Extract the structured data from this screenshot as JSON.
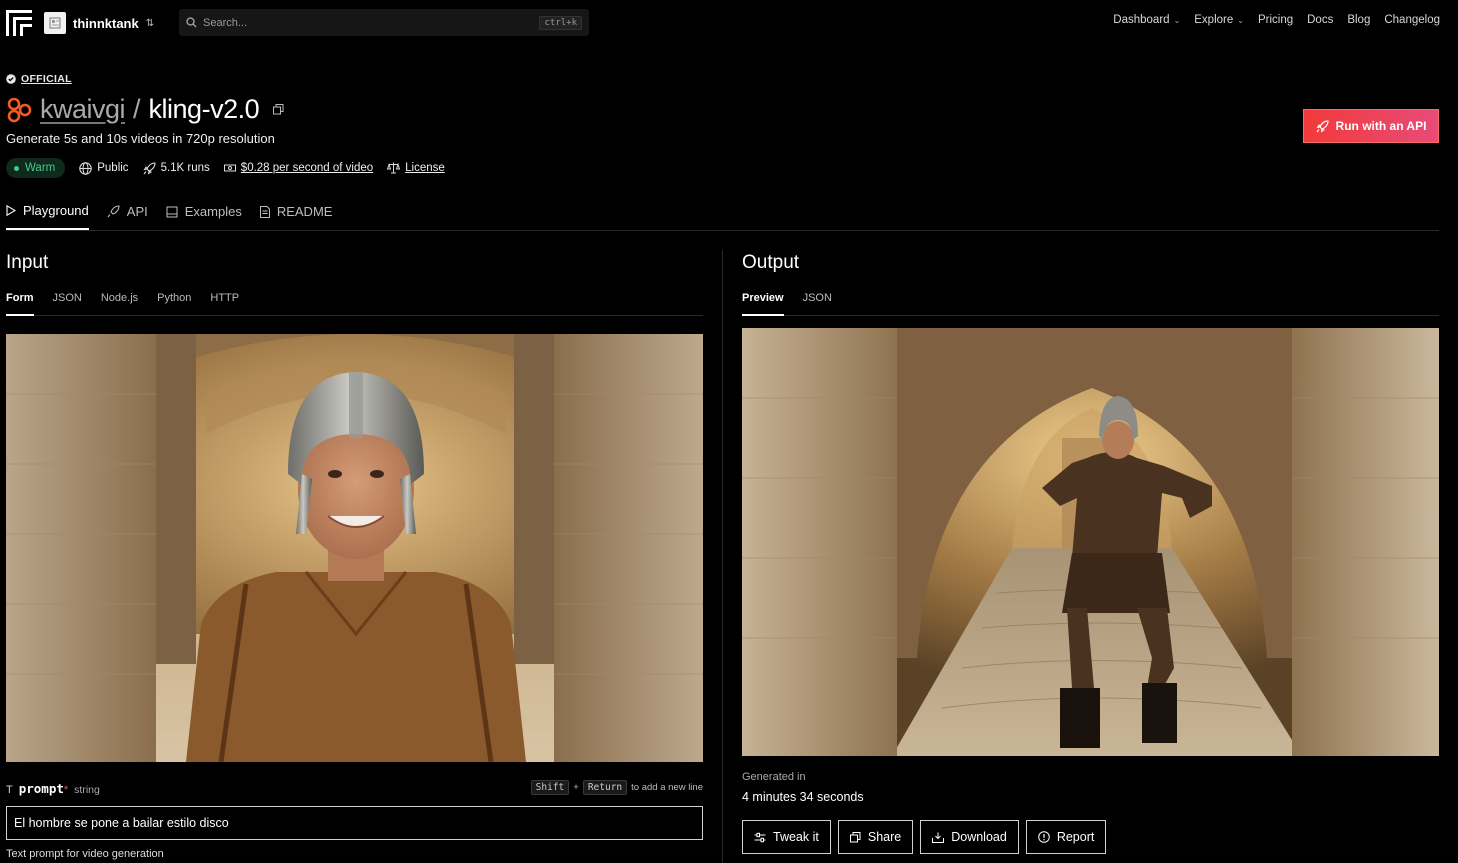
{
  "header": {
    "org_name": "thinnktank",
    "search_placeholder": "Search...",
    "search_shortcut": "ctrl+k",
    "nav": [
      {
        "label": "Dashboard",
        "has_menu": true
      },
      {
        "label": "Explore",
        "has_menu": true
      },
      {
        "label": "Pricing",
        "has_menu": false
      },
      {
        "label": "Docs",
        "has_menu": false
      },
      {
        "label": "Blog",
        "has_menu": false
      },
      {
        "label": "Changelog",
        "has_menu": false
      }
    ]
  },
  "model": {
    "badge": "OFFICIAL",
    "owner": "kwaivgi",
    "separator": "/",
    "name": "kling-v2.0",
    "description": "Generate 5s and 10s videos in 720p resolution",
    "status": "Warm",
    "visibility": "Public",
    "runs": "5.1K runs",
    "price": "$0.28 per second of video",
    "license": "License",
    "run_api_label": "Run with an API"
  },
  "tabs": [
    {
      "label": "Playground",
      "icon": "play-icon",
      "active": true
    },
    {
      "label": "API",
      "icon": "rocket-icon",
      "active": false
    },
    {
      "label": "Examples",
      "icon": "book-icon",
      "active": false
    },
    {
      "label": "README",
      "icon": "document-icon",
      "active": false
    }
  ],
  "input": {
    "title": "Input",
    "subtabs": [
      "Form",
      "JSON",
      "Node.js",
      "Python",
      "HTTP"
    ],
    "active_subtab": "Form",
    "field": {
      "name": "prompt",
      "required_mark": "*",
      "type": "string",
      "shortcut_key1": "Shift",
      "shortcut_plus": "+",
      "shortcut_key2": "Return",
      "shortcut_text": "to add a new line",
      "value": "El hombre se pone a bailar estilo disco",
      "help": "Text prompt for video generation"
    }
  },
  "output": {
    "title": "Output",
    "subtabs": [
      "Preview",
      "JSON"
    ],
    "active_subtab": "Preview",
    "generated_label": "Generated in",
    "generated_value": "4 minutes 34 seconds",
    "actions": [
      {
        "label": "Tweak it",
        "icon": "sliders-icon"
      },
      {
        "label": "Share",
        "icon": "copy-icon"
      },
      {
        "label": "Download",
        "icon": "download-icon"
      },
      {
        "label": "Report",
        "icon": "alert-icon"
      }
    ]
  },
  "colors": {
    "accent_red": "#f23a3a",
    "accent_pink": "#e84b7a",
    "warm_green": "#44c98a",
    "brand_orange": "#f25c1e"
  }
}
